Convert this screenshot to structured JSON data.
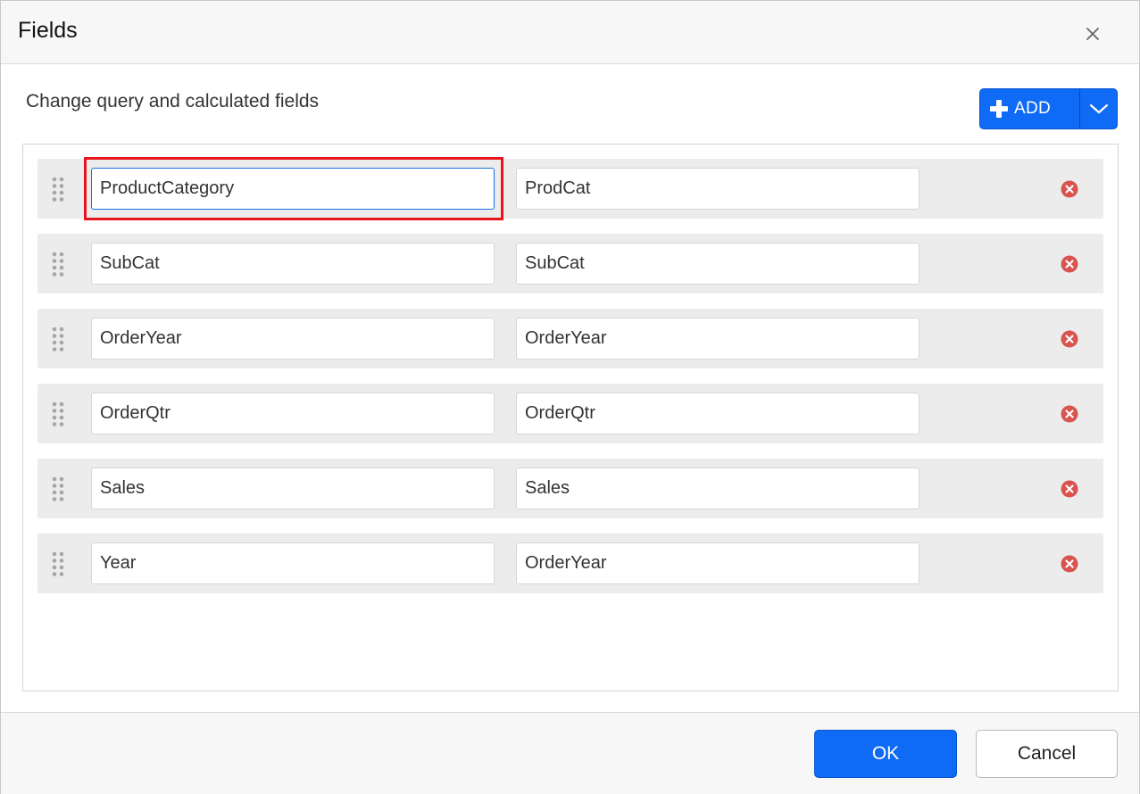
{
  "dialog": {
    "title": "Fields",
    "subtitle": "Change query and calculated fields"
  },
  "toolbar": {
    "add_label": "ADD"
  },
  "fields": [
    {
      "name": "ProductCategory",
      "alias": "ProdCat"
    },
    {
      "name": "SubCat",
      "alias": "SubCat"
    },
    {
      "name": "OrderYear",
      "alias": "OrderYear"
    },
    {
      "name": "OrderQtr",
      "alias": "OrderQtr"
    },
    {
      "name": "Sales",
      "alias": "Sales"
    },
    {
      "name": "Year",
      "alias": "OrderYear"
    }
  ],
  "footer": {
    "ok_label": "OK",
    "cancel_label": "Cancel"
  },
  "colors": {
    "primary": "#0f6af5",
    "remove_icon": "#d9534f",
    "highlight": "#e8141b"
  },
  "icons": {
    "close": "close-icon",
    "add": "plus-icon",
    "dropdown": "chevron-down-icon",
    "drag": "drag-handle-icon",
    "remove": "remove-circle-icon"
  }
}
